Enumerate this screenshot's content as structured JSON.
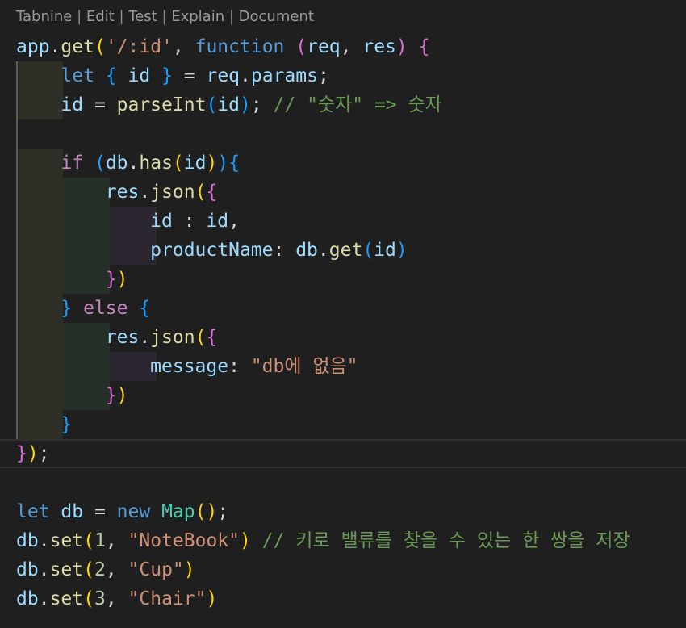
{
  "editor": {
    "codelens": {
      "items": [
        "Tabnine",
        "Edit",
        "Test",
        "Explain",
        "Document"
      ],
      "separator": " | "
    },
    "code_lines": [
      "app.get('/:id', function (req, res) {",
      "    let { id } = req.params;",
      "    id = parseInt(id); // \"숫자\" => 숫자",
      "",
      "    if (db.has(id)){",
      "        res.json({",
      "            id : id,",
      "            productName: db.get(id)",
      "        })",
      "    } else {",
      "        res.json({",
      "            message: \"db에 없음\"",
      "        })",
      "    }",
      "});",
      "",
      "let db = new Map();",
      "db.set(1, \"NoteBook\") // 키로 밸류를 찾을 수 있는 한 쌍을 저장",
      "db.set(2, \"Cup\")",
      "db.set(3, \"Chair\")"
    ],
    "tokens": {
      "app": "app",
      "get": "get",
      "route": "'/:id'",
      "function": "function",
      "req": "req",
      "res": "res",
      "let": "let",
      "id": "id",
      "params": "params",
      "parseInt": "parseInt",
      "comment1": "// \"숫자\" => 숫자",
      "if": "if",
      "db": "db",
      "has": "has",
      "json": "json",
      "productName": "productName",
      "else": "else",
      "message": "message",
      "message_value": "\"db에 없음\"",
      "new": "new",
      "Map": "Map",
      "set": "set",
      "one": "1",
      "two": "2",
      "three": "3",
      "notebook": "\"NoteBook\"",
      "cup": "\"Cup\"",
      "chair": "\"Chair\"",
      "comment2": "// 키로 밸류를 찾을 수 있는 한 쌍을 저장"
    },
    "colors": {
      "background": "#1f1f1f",
      "keyword": "#569cd6",
      "function": "#dcdcaa",
      "variable": "#9cdcfe",
      "string": "#ce9178",
      "number": "#b5cea8",
      "comment": "#6a9955",
      "class": "#4ec9b0",
      "bracket_gold": "#ffd700",
      "bracket_pink": "#da70d6",
      "bracket_blue": "#179fff"
    }
  }
}
